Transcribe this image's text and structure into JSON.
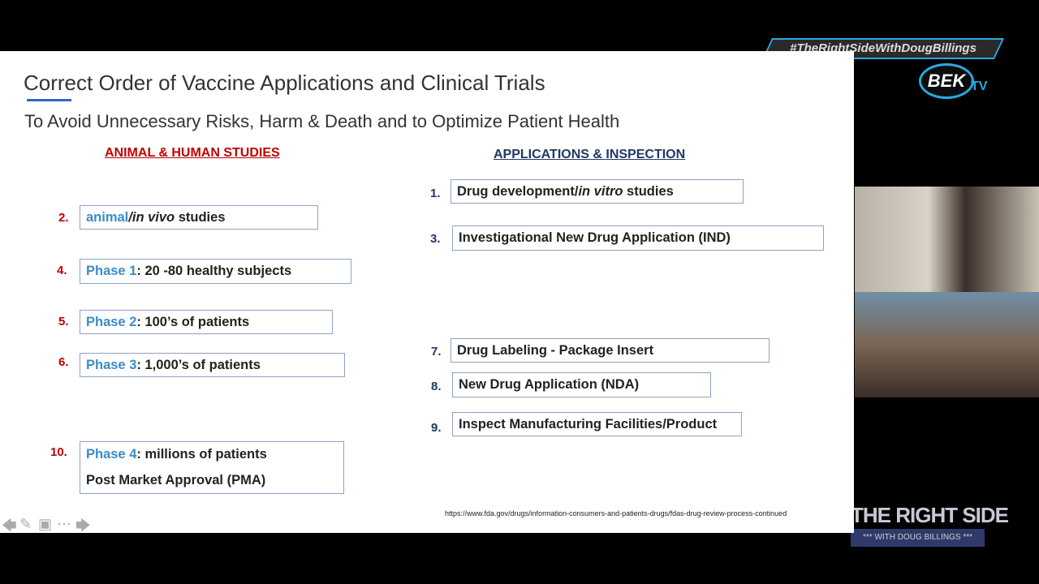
{
  "overlay": {
    "hashtag": "#TheRightSideWithDougBillings",
    "bek_logo": "BEK",
    "bek_tv": "TV",
    "show_logo": "THE RIGHT SIDE",
    "show_logo_sub": "*** WITH DOUG BILLINGS ***"
  },
  "slide": {
    "title": "Correct Order of Vaccine Applications and Clinical Trials",
    "subtitle": "To Avoid Unnecessary Risks, Harm & Death and to Optimize Patient Health",
    "left_header": "ANIMAL & HUMAN STUDIES",
    "right_header": "APPLICATIONS & INSPECTION",
    "left_items": [
      {
        "num": "2.",
        "hl": "animal",
        "italic": "/in vivo",
        "rest": " studies"
      },
      {
        "num": "4.",
        "hl": "Phase 1",
        "rest": ": 20 -80 healthy subjects"
      },
      {
        "num": "5.",
        "hl": "Phase 2",
        "rest": ": 100’s of patients"
      },
      {
        "num": "6.",
        "hl": "Phase 3",
        "rest": ": 1,000’s of patients"
      },
      {
        "num": "10.",
        "hl": "Phase 4",
        "rest": ": millions of patients",
        "line2": "Post Market Approval (PMA)"
      }
    ],
    "right_items": [
      {
        "num": "1.",
        "pre": "Drug development/",
        "italic": "in vitro",
        "rest": " studies"
      },
      {
        "num": "3.",
        "pre": "Investigational New Drug Application (IND)"
      },
      {
        "num": "7.",
        "pre": "Drug Labeling - Package Insert"
      },
      {
        "num": "8.",
        "pre": "New Drug Application (NDA)"
      },
      {
        "num": "9.",
        "pre": "Inspect Manufacturing Facilities/Product"
      }
    ],
    "source_url": "https://www.fda.gov/drugs/information-consumers-and-patients-drugs/fdas-drug-review-process-continued"
  },
  "controls": {
    "prev": "🡄",
    "pen": "✎",
    "slides": "▣",
    "more": "⋯",
    "next": "🡆"
  }
}
